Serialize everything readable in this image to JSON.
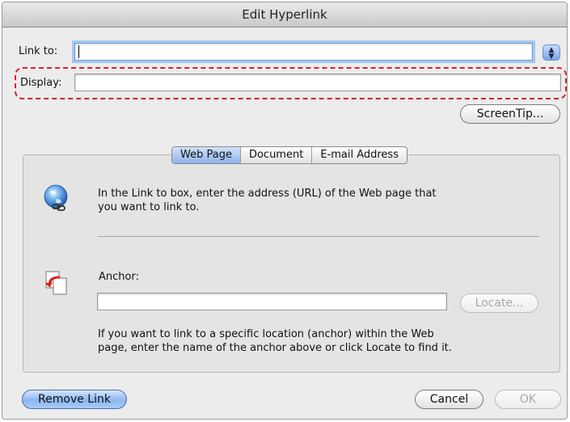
{
  "window": {
    "title": "Edit Hyperlink"
  },
  "form": {
    "link_to_label": "Link to:",
    "link_to_value": "",
    "display_label": "Display:",
    "display_value": "",
    "screentip_label": "ScreenTip..."
  },
  "tabs": [
    {
      "label": "Web Page",
      "active": true
    },
    {
      "label": "Document",
      "active": false
    },
    {
      "label": "E-mail Address",
      "active": false
    }
  ],
  "web_page": {
    "help_text_line1": "In the Link to box, enter the address (URL) of the Web page that",
    "help_text_line2": "you want to link to.",
    "anchor_label": "Anchor:",
    "anchor_value": "",
    "locate_label": "Locate...",
    "anchor_help_line1": "If you want to link to a specific location (anchor) within the Web",
    "anchor_help_line2": "page, enter the name of the anchor above or click Locate to find it."
  },
  "footer": {
    "remove_link_label": "Remove Link",
    "cancel_label": "Cancel",
    "ok_label": "OK"
  },
  "icons": {
    "globe": "globe-link-icon",
    "anchor": "anchor-document-icon",
    "stepper": "stepper-arrows-icon"
  },
  "colors": {
    "highlight_dashed": "#d5232a",
    "accent_blue": "#8db6f0",
    "window_bg": "#ececec"
  }
}
